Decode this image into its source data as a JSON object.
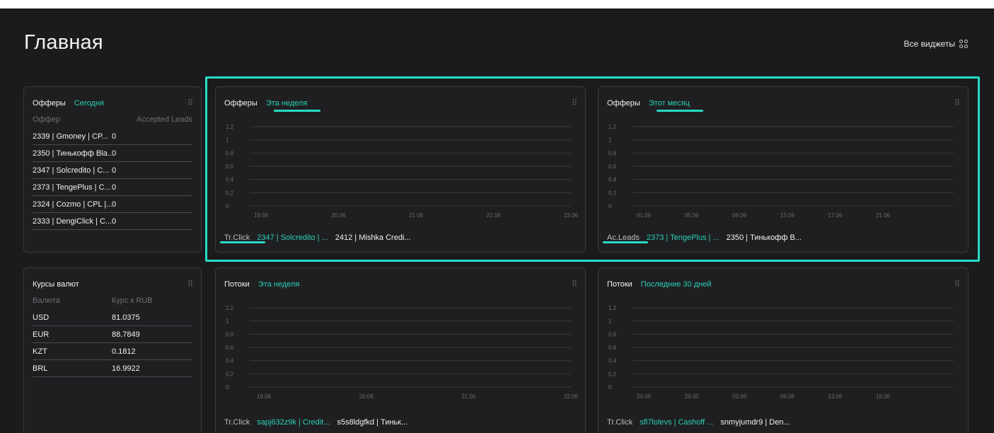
{
  "page": {
    "title": "Главная",
    "all_widgets": "Все виджеты"
  },
  "colors": {
    "accent": "#27dcc4",
    "background": "#1b1b1d",
    "card": "#1f1f21"
  },
  "offers_table": {
    "title": "Офферы",
    "period": "Сегодня",
    "col_offer": "Оффер",
    "col_leads": "Accepted Leads",
    "rows": [
      {
        "offer": "2339 | Gmoney | CP...",
        "leads": "0"
      },
      {
        "offer": "2350 | Тинькофф Bla...",
        "leads": "0"
      },
      {
        "offer": "2347 | Solcredito | C...",
        "leads": "0"
      },
      {
        "offer": "2373 | TengePlus | C...",
        "leads": "0"
      },
      {
        "offer": "2324 | Cozmo | CPL |...",
        "leads": "0"
      },
      {
        "offer": "2333 | DengiClick | C...",
        "leads": "0"
      }
    ]
  },
  "currency": {
    "title": "Курсы валют",
    "col_currency": "Валюта",
    "col_rate": "Курс к RUB",
    "rows": [
      {
        "code": "USD",
        "rate": "81.0375"
      },
      {
        "code": "EUR",
        "rate": "88.7849"
      },
      {
        "code": "KZT",
        "rate": "0.1812"
      },
      {
        "code": "BRL",
        "rate": "16.9922"
      }
    ]
  },
  "widgets": [
    {
      "title": "Офферы",
      "period": "Эта неделя",
      "legend_metric": "Tr.Click",
      "legend_a": "2347 | Solcredito | ...",
      "legend_b": "2412 | Mishka Credi..."
    },
    {
      "title": "Офферы",
      "period": "Этот месяц",
      "legend_metric": "Ac.Leads",
      "legend_a": "2373 | TengePlus | ...",
      "legend_b": "2350 | Тинькофф B..."
    },
    {
      "title": "Потоки",
      "period": "Эта неделя",
      "legend_metric": "Tr.Click",
      "legend_a": "sapj632z9k | Credit...",
      "legend_b": "s5s8ldgfkd | Тиньк..."
    },
    {
      "title": "Потоки",
      "period": "Последние 30 дней",
      "legend_metric": "Tr.Click",
      "legend_a": "sfl7lolevs | Cashoff ...",
      "legend_b": "snmyjumdr9 | Den..."
    }
  ],
  "chart_data": [
    {
      "type": "line",
      "x": [
        "19.06",
        "20.06",
        "21.06",
        "22.06",
        "23.06"
      ],
      "y_ticks": [
        "1.2",
        "1",
        "0.8",
        "0.6",
        "0.4",
        "0.2",
        "0"
      ],
      "ylim": [
        0,
        1.2
      ],
      "grid": true,
      "series": []
    },
    {
      "type": "line",
      "x": [
        "01.06",
        "05.06",
        "09.06",
        "13.06",
        "17.06",
        "21.06"
      ],
      "y_ticks": [
        "1.2",
        "1",
        "0.8",
        "0.6",
        "0.4",
        "0.2",
        "0"
      ],
      "ylim": [
        0,
        1.2
      ],
      "grid": true,
      "series": []
    },
    {
      "type": "line",
      "x": [
        "19.06",
        "20.06",
        "21.06",
        "22.06"
      ],
      "y_ticks": [
        "1.2",
        "1",
        "0.8",
        "0.6",
        "0.4",
        "0.2",
        "0"
      ],
      "ylim": [
        0,
        1.2
      ],
      "grid": true,
      "series": []
    },
    {
      "type": "line",
      "x": [
        "24.05",
        "29.05",
        "03.06",
        "08.06",
        "13.06",
        "18.06"
      ],
      "y_ticks": [
        "1.2",
        "1",
        "0.8",
        "0.6",
        "0.4",
        "0.2",
        "0"
      ],
      "ylim": [
        0,
        1.2
      ],
      "grid": true,
      "series": []
    }
  ]
}
